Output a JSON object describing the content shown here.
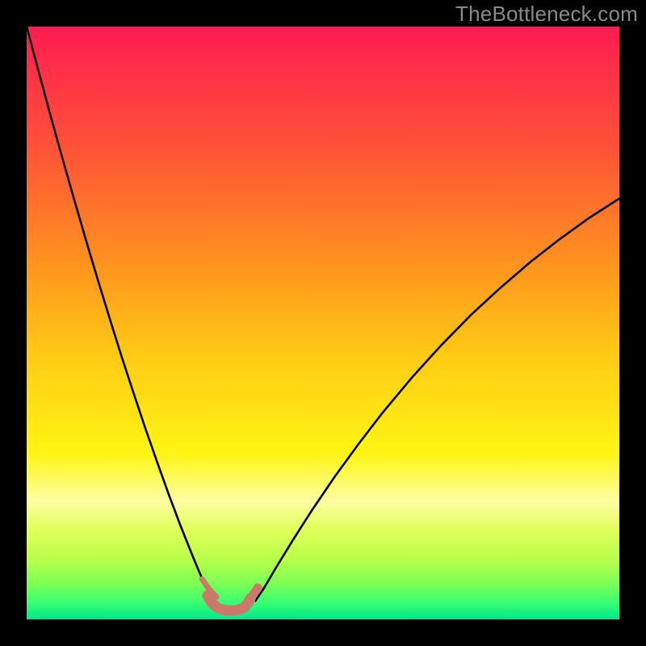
{
  "watermark": "TheBottleneck.com",
  "chart_data": {
    "type": "line",
    "title": "",
    "xlabel": "",
    "ylabel": "",
    "xlim": [
      0,
      100
    ],
    "ylim": [
      0,
      100
    ],
    "grid": false,
    "legend": false,
    "background_gradient": {
      "stops": [
        {
          "offset": 0.0,
          "color": "#ff1c52"
        },
        {
          "offset": 0.2,
          "color": "#ff5138"
        },
        {
          "offset": 0.4,
          "color": "#ff931f"
        },
        {
          "offset": 0.55,
          "color": "#ffc915"
        },
        {
          "offset": 0.72,
          "color": "#fff514"
        },
        {
          "offset": 0.8,
          "color": "#fdffa2"
        },
        {
          "offset": 0.85,
          "color": "#e0ff58"
        },
        {
          "offset": 0.9,
          "color": "#b7ff4a"
        },
        {
          "offset": 0.94,
          "color": "#7bff55"
        },
        {
          "offset": 0.97,
          "color": "#3dff71"
        },
        {
          "offset": 1.0,
          "color": "#00e78d"
        }
      ]
    },
    "series": [
      {
        "name": "left-branch",
        "stroke": "#000000",
        "width": 2.6,
        "x": [
          0,
          2,
          4,
          6,
          8,
          10,
          12,
          14,
          16,
          18,
          20,
          22,
          24,
          26,
          28,
          29,
          30,
          31,
          31.5
        ],
        "y": [
          100.0,
          92.5,
          85.1,
          77.9,
          70.9,
          64.0,
          57.3,
          50.8,
          44.4,
          38.3,
          32.3,
          26.6,
          21.0,
          15.7,
          10.7,
          8.3,
          6.0,
          3.9,
          2.9
        ]
      },
      {
        "name": "right-branch",
        "stroke": "#000000",
        "width": 2.6,
        "x": [
          38.5,
          40,
          42,
          45,
          48,
          52,
          56,
          60,
          65,
          70,
          75,
          80,
          85,
          90,
          95,
          100
        ],
        "y": [
          3.0,
          5.2,
          8.6,
          13.5,
          18.2,
          24.1,
          29.6,
          34.8,
          40.8,
          46.3,
          51.4,
          56.0,
          60.3,
          64.2,
          67.8,
          71.0
        ]
      },
      {
        "name": "valley-marker-lower",
        "stroke": "#c97a6b",
        "width": 13,
        "linecap": "round",
        "x": [
          30.5,
          31.2,
          32.3,
          33.6,
          35.2,
          36.6,
          37.3,
          37.8
        ],
        "y": [
          4.0,
          2.8,
          1.9,
          1.5,
          1.5,
          1.9,
          2.7,
          3.6
        ]
      },
      {
        "name": "valley-marker-upper",
        "stroke": "#c97a6b",
        "width": 7,
        "linecap": "round",
        "x": [
          29.6,
          30.4,
          31.2,
          32.0
        ],
        "y": [
          6.8,
          5.6,
          4.6,
          3.8
        ]
      },
      {
        "name": "valley-marker-right-dot",
        "stroke": "#c97a6b",
        "width": 11,
        "linecap": "round",
        "x": [
          38.3,
          39.0
        ],
        "y": [
          4.3,
          5.3
        ]
      }
    ]
  }
}
